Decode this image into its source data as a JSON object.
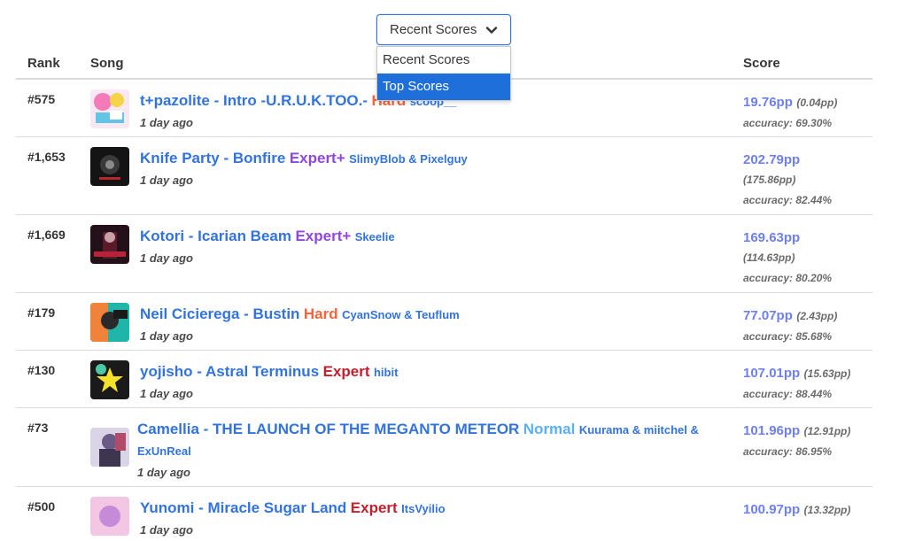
{
  "dropdown": {
    "selected": "Recent Scores",
    "options": [
      {
        "label": "Recent Scores",
        "selected": false
      },
      {
        "label": "Top Scores",
        "selected": true
      }
    ]
  },
  "headers": {
    "rank": "Rank",
    "song": "Song",
    "score": "Score"
  },
  "colors": {
    "link": "#3273dc",
    "pp": "#6e7ff0",
    "Hard": "#f5653b",
    "Expert": "#c2202f",
    "ExpertPlus": "#8f48db",
    "Normal": "#59b0f4"
  },
  "rows": [
    {
      "rank": "#575",
      "title": "t+pazolite - Intro -U.R.U.K.TOO.-",
      "diff": "Hard",
      "diff_color": "#f5653b",
      "mapper": "scoop__",
      "ago": "1 day ago",
      "pp": "19.76pp",
      "weighted": "(0.04pp)",
      "acc": "accuracy: 69.30%",
      "cover_icon": "cover-art-colorful"
    },
    {
      "rank": "#1,653",
      "title": "Knife Party - Bonfire",
      "diff": "Expert+",
      "diff_color": "#8f48db",
      "mapper": "SlimyBlob & Pixelguy",
      "ago": "1 day ago",
      "pp": "202.79pp",
      "weighted": "(175.86pp)",
      "acc": "accuracy: 82.44%",
      "cover_icon": "cover-art-dark"
    },
    {
      "rank": "#1,669",
      "title": "Kotori - Icarian Beam",
      "diff": "Expert+",
      "diff_color": "#8f48db",
      "mapper": "Skeelie",
      "ago": "1 day ago",
      "pp": "169.63pp",
      "weighted": "(114.63pp)",
      "acc": "accuracy: 80.20%",
      "cover_icon": "cover-art-red-dark"
    },
    {
      "rank": "#179",
      "title": "Neil Cicierega - Bustin",
      "diff": "Hard",
      "diff_color": "#f5653b",
      "mapper": "CyanSnow & Teuflum",
      "ago": "1 day ago",
      "pp": "77.07pp",
      "weighted": "(2.43pp)",
      "acc": "accuracy: 85.68%",
      "cover_icon": "cover-art-teal"
    },
    {
      "rank": "#130",
      "title": "yojisho - Astral Terminus",
      "diff": "Expert",
      "diff_color": "#c2202f",
      "mapper": "hibit",
      "ago": "1 day ago",
      "pp": "107.01pp",
      "weighted": "(15.63pp)",
      "acc": "accuracy: 88.44%",
      "cover_icon": "cover-art-star"
    },
    {
      "rank": "#73",
      "title": "Camellia - THE LAUNCH OF THE MEGANTO METEOR",
      "diff": "Normal",
      "diff_color": "#59b0f4",
      "mapper": "Kuurama & miitchel & ExUnReal",
      "ago": "1 day ago",
      "pp": "101.96pp",
      "weighted": "(12.91pp)",
      "acc": "accuracy: 86.95%",
      "cover_icon": "cover-art-anime"
    },
    {
      "rank": "#500",
      "title": "Yunomi - Miracle Sugar Land",
      "diff": "Expert",
      "diff_color": "#c2202f",
      "mapper": "ItsVyilio",
      "ago": "1 day ago",
      "pp": "100.97pp",
      "weighted": "(13.32pp)",
      "acc": "",
      "cover_icon": "cover-art-pink"
    }
  ]
}
